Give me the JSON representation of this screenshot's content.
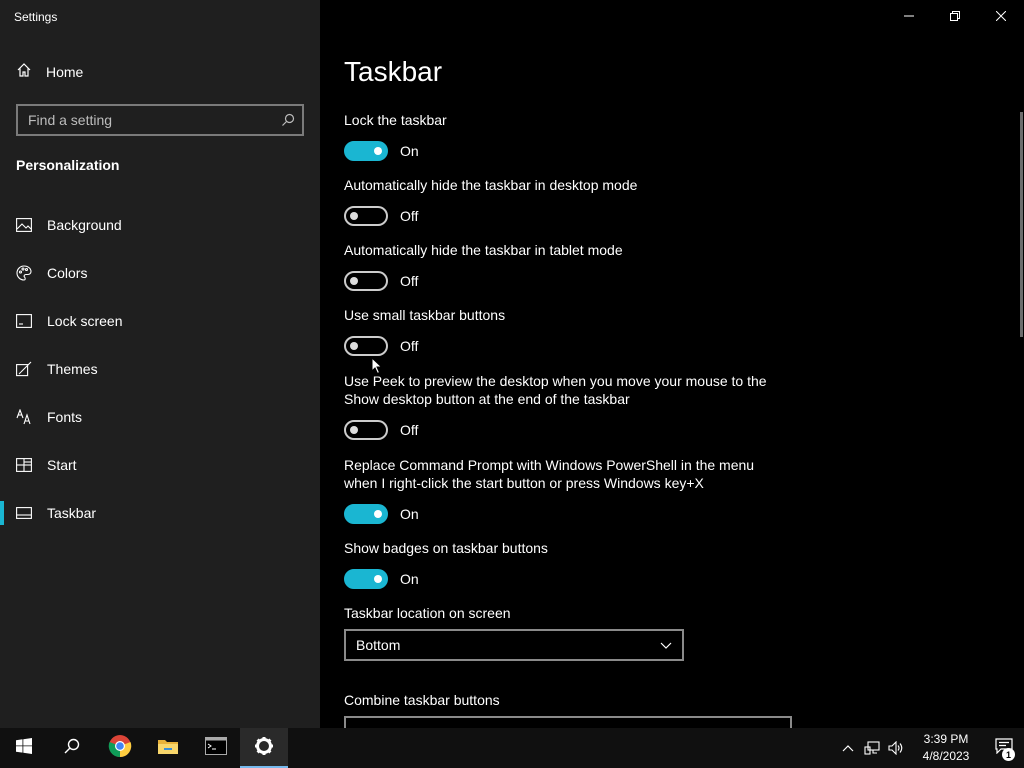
{
  "app": {
    "title": "Settings"
  },
  "sidebar": {
    "home_label": "Home",
    "search_placeholder": "Find a setting",
    "section": "Personalization",
    "items": [
      {
        "label": "Background",
        "icon": "picture-icon"
      },
      {
        "label": "Colors",
        "icon": "palette-icon"
      },
      {
        "label": "Lock screen",
        "icon": "lock-screen-icon"
      },
      {
        "label": "Themes",
        "icon": "brush-icon"
      },
      {
        "label": "Fonts",
        "icon": "font-icon"
      },
      {
        "label": "Start",
        "icon": "start-layout-icon"
      },
      {
        "label": "Taskbar",
        "icon": "taskbar-icon",
        "active": true
      }
    ]
  },
  "main": {
    "title": "Taskbar",
    "settings": [
      {
        "label": "Lock the taskbar",
        "state": "On"
      },
      {
        "label": "Automatically hide the taskbar in desktop mode",
        "state": "Off"
      },
      {
        "label": "Automatically hide the taskbar in tablet mode",
        "state": "Off"
      },
      {
        "label": "Use small taskbar buttons",
        "state": "Off"
      },
      {
        "label": "Use Peek to preview the desktop when you move your mouse to the Show desktop button at the end of the taskbar",
        "state": "Off"
      },
      {
        "label": "Replace Command Prompt with Windows PowerShell in the menu when I right-click the start button or press Windows key+X",
        "state": "On"
      },
      {
        "label": "Show badges on taskbar buttons",
        "state": "On"
      }
    ],
    "location_label": "Taskbar location on screen",
    "location_value": "Bottom",
    "combine_label": "Combine taskbar buttons"
  },
  "taskbar": {
    "time": "3:39 PM",
    "date": "4/8/2023",
    "notification_count": "1"
  },
  "colors": {
    "accent": "#1ab6d2"
  }
}
